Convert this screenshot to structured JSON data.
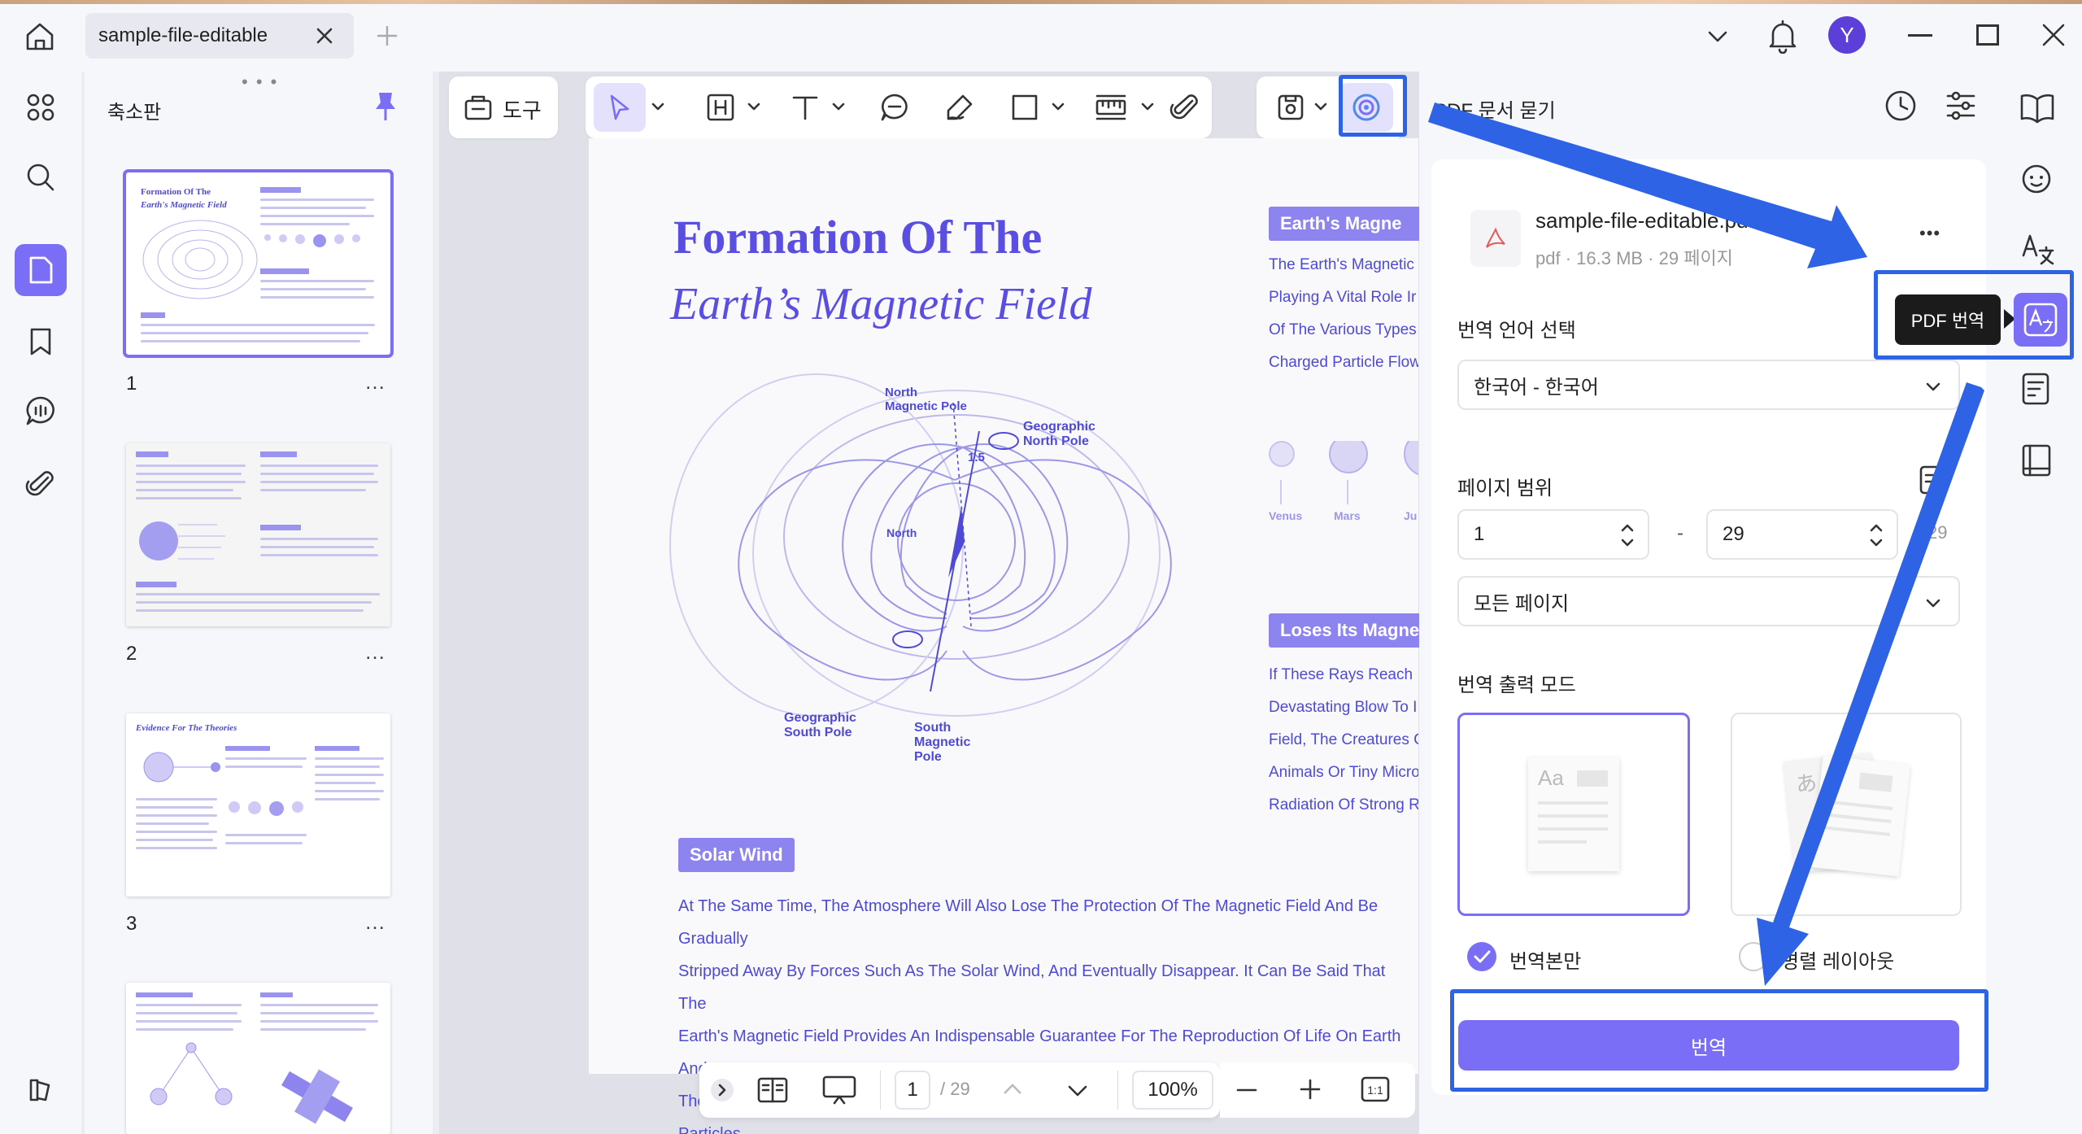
{
  "window": {
    "tab_title": "sample-file-editable",
    "avatar_letter": "Y"
  },
  "thumbnails": {
    "title": "축소판",
    "pages": [
      {
        "number": "1",
        "more": "…"
      },
      {
        "number": "2",
        "more": "…"
      },
      {
        "number": "3",
        "more": "…"
      }
    ],
    "thumb3_heading": "Evidence For The Theories",
    "thumb1_title_line1": "Formation Of The",
    "thumb1_title_line2": "Earth's Magnetic Field"
  },
  "toolbar": {
    "tools_label": "도구"
  },
  "document": {
    "title_line1": "Formation Of The",
    "title_line2": "Earth’s Magnetic Field",
    "diagram": {
      "north_magnetic_pole": [
        "North",
        "Magnetic Pole"
      ],
      "geographic_north_pole": [
        "Geographic",
        "North Pole"
      ],
      "geographic_south_pole": [
        "Geographic",
        "South Pole"
      ],
      "south_magnetic_pole": [
        "South",
        "Magnetic",
        "Pole"
      ],
      "angle": "1.5"
    },
    "tag_magnetic": "Earth's Magne",
    "side_lines_1": [
      "The Earth's Magnetic",
      "Playing A Vital Role Ir",
      "Of The Various Types",
      "Charged Particle Flow"
    ],
    "planets": [
      "Venus",
      "Mars",
      "Ju"
    ],
    "tag_loses": "Loses Its Magne",
    "side_lines_2": [
      "If These Rays Reach",
      "Devastating Blow To I",
      "Field, The Creatures C",
      "Animals Or Tiny Micro",
      "Radiation Of Strong R"
    ],
    "tag_solar": "Solar Wind",
    "body_lines": [
      "At The Same Time, The Atmosphere Will Also Lose The Protection Of The Magnetic Field And Be Gradually",
      "Stripped Away By Forces Such As The Solar Wind, And Eventually Disappear. It Can Be Said That The",
      "Earth's Magnetic Field Provides An Indispensable Guarantee For The Reproduction Of Life On Earth And",
      "The Stable Existence Of The Atmosphere By Shielding Dangerous Substances Such As Solar Particles."
    ]
  },
  "bottombar": {
    "current_page": "1",
    "total_pages": "/ 29",
    "zoom": "100%"
  },
  "panel": {
    "title": "PDF 문서 묻기",
    "file_name": "sample-file-editable.pd",
    "file_meta": "pdf · 16.3 MB · 29 페이지",
    "more": "•••",
    "lang_label": "번역 언어 선택",
    "lang_value": "한국어 - 한국어",
    "range_label": "페이지 범위",
    "range_from": "1",
    "range_dash": "-",
    "range_to": "29",
    "range_total": "29",
    "range_mode": "모든 페이지",
    "output_label": "번역 출력 모드",
    "mode1_label": "번역본만",
    "mode2_label": "병렬 레이아웃",
    "mode1_glyph": "Aa",
    "mode2_glyph": "あ",
    "translate_button": "번역"
  },
  "tooltip": {
    "text": "PDF 번역"
  },
  "colors": {
    "accent": "#7b6ef6",
    "annotation": "#2f63e6",
    "doc_text": "#4f4ad6"
  }
}
